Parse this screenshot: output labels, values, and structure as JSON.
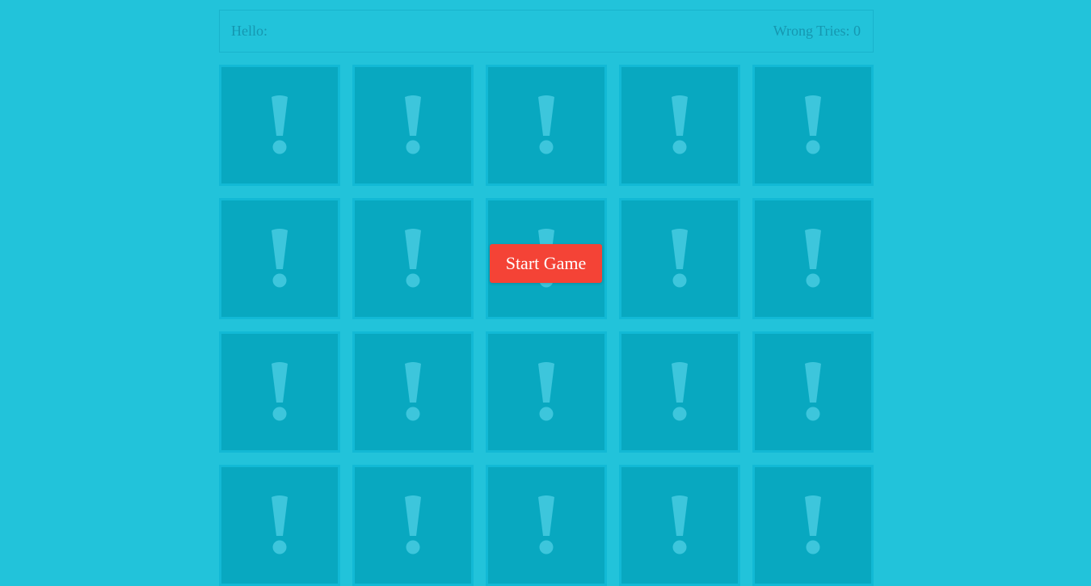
{
  "header": {
    "greeting_label": "Hello:",
    "wrong_tries_label": "Wrong Tries: 0"
  },
  "board": {
    "columns": 5,
    "visible_rows": 4,
    "card_face_icon": "exclamation-icon",
    "colors": {
      "background": "#22c3da",
      "card": "#08a8c0",
      "card_border": "#12b9d5",
      "icon": "#3dc6dc"
    }
  },
  "start_button": {
    "label": "Start Game",
    "color": "#f44336"
  }
}
